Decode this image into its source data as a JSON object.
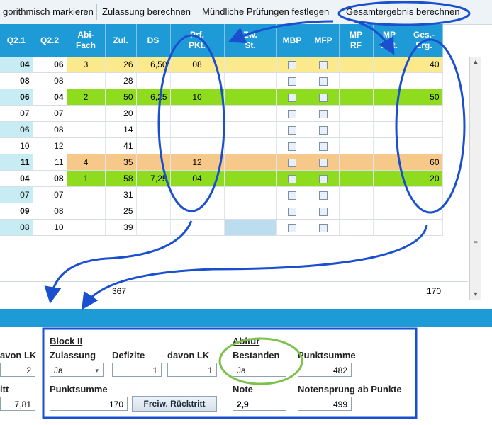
{
  "toolbar": {
    "items": [
      "gorithmisch markieren",
      "Zulassung berechnen",
      "Mündliche Prüfungen festlegen",
      "Gesamtergebnis berechnen"
    ]
  },
  "grid": {
    "columns": [
      "Q2.1",
      "Q2.2",
      "Abi-\nFach",
      "Zul.",
      "DS",
      "Prf.\nPKt.",
      "Zw.\nSt.",
      "MBP",
      "MFP",
      "MP\nRF",
      "MP\nPKt.",
      "Ges.-\nErg."
    ],
    "rows": [
      {
        "q21": "04",
        "q21r": true,
        "q22": "06",
        "q22b": true,
        "abi": "3",
        "zul": "26",
        "ds": "6,50",
        "prf": "08",
        "ges": "40",
        "hl": "yellow"
      },
      {
        "q21": "08",
        "q21b": true,
        "q22": "08",
        "abi": "",
        "zul": "28",
        "ds": "",
        "prf": "",
        "ges": "",
        "hl": ""
      },
      {
        "q21": "06",
        "q21b": true,
        "q22": "04",
        "q22r": true,
        "abi": "2",
        "zul": "50",
        "ds": "6,25",
        "prf": "10",
        "ges": "50",
        "hl": "green"
      },
      {
        "q21": "07",
        "q22": "07",
        "abi": "",
        "zul": "20",
        "ds": "",
        "prf": "",
        "ges": "",
        "hl": ""
      },
      {
        "q21": "06",
        "q22": "08",
        "abi": "",
        "zul": "14",
        "ds": "",
        "prf": "",
        "ges": "",
        "hl": ""
      },
      {
        "q21": "10",
        "q22": "12",
        "abi": "",
        "zul": "41",
        "ds": "",
        "prf": "",
        "ges": "",
        "hl": ""
      },
      {
        "q21": "11",
        "q21b": true,
        "q22": "11",
        "abi": "4",
        "zul": "35",
        "ds": "",
        "prf": "12",
        "ges": "60",
        "hl": "orange"
      },
      {
        "q21": "04",
        "q21r": true,
        "q22": "08",
        "q22b": true,
        "abi": "1",
        "zul": "58",
        "ds": "7,25",
        "prf": "04",
        "ges": "20",
        "hl": "green"
      },
      {
        "q21": "07",
        "q22": "07",
        "abi": "",
        "zul": "31",
        "ds": "",
        "prf": "",
        "ges": "",
        "hl": ""
      },
      {
        "q21": "09",
        "q21b": true,
        "q22": "08",
        "abi": "",
        "zul": "25",
        "ds": "",
        "prf": "",
        "ges": "",
        "hl": ""
      },
      {
        "q21": "08",
        "q22": "10",
        "abi": "",
        "zul": "39",
        "ds": "",
        "prf": "",
        "ges": "",
        "hl": ""
      }
    ],
    "sum_zul": "367",
    "sum_ges": "170"
  },
  "lower": {
    "left_cut_label_1": "avon LK",
    "left_cut_value_1": "2",
    "left_cut_label_2": "itt",
    "left_cut_value_2": "7,81",
    "block_title": "Block II",
    "zulassung_label": "Zulassung",
    "zulassung_value": "Ja",
    "defizite_label": "Defizite",
    "defizite_value": "1",
    "davon_lk_label": "davon LK",
    "davon_lk_value": "1",
    "punktsumme_label": "Punktsumme",
    "punktsumme_value": "170",
    "freiw_button": "Freiw. Rücktritt",
    "abitur_title": "Abitur",
    "bestanden_label": "Bestanden",
    "bestanden_value": "Ja",
    "note_label": "Note",
    "note_value": "2,9",
    "punktsumme2_label": "Punktsumme",
    "punktsumme2_value": "482",
    "notensprung_label": "Notensprung ab Punkte",
    "notensprung_value": "499"
  },
  "colors": {
    "header_blue": "#1e9ad6",
    "highlight_yellow": "#fbe98c",
    "highlight_green": "#8fdc1e",
    "highlight_orange": "#f6c98a",
    "annotation_blue": "#1a4fd0",
    "annotation_green": "#7cc24a"
  }
}
